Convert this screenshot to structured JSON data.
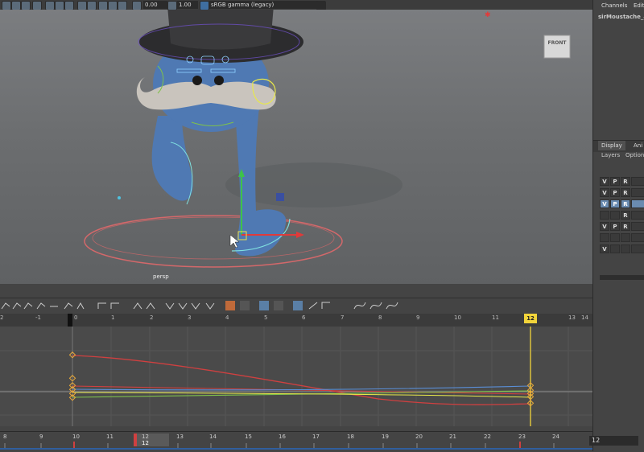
{
  "toolbar": {
    "exposure_value": "0.00",
    "gamma_value": "1.00",
    "color_space": "sRGB gamma (legacy)"
  },
  "viewport": {
    "camera_label": "persp",
    "view_cube_label": "FRONT"
  },
  "right_panel": {
    "tabs": [
      "Channels",
      "Edit"
    ],
    "object_name": "sirMoustache_ani",
    "display_tabs": [
      "Display",
      "Ani"
    ],
    "submenu": [
      "Layers",
      "Options"
    ],
    "layers": [
      {
        "flags": [
          "V",
          "P",
          "R"
        ],
        "selected": false
      },
      {
        "flags": [
          "V",
          "P",
          "R"
        ],
        "selected": false
      },
      {
        "flags": [
          "V",
          "P",
          "R"
        ],
        "selected": true
      },
      {
        "flags": [
          "",
          "",
          "R"
        ],
        "selected": false
      },
      {
        "flags": [
          "V",
          "P",
          "R"
        ],
        "selected": false
      },
      {
        "flags": [
          "",
          "",
          ""
        ],
        "selected": false
      },
      {
        "flags": [
          "V",
          "",
          ""
        ],
        "selected": false
      }
    ]
  },
  "graph_editor": {
    "ruler_labels": [
      "2",
      "-1",
      "0",
      "1",
      "2",
      "3",
      "4",
      "5",
      "6",
      "7",
      "8",
      "9",
      "10",
      "11",
      "12",
      "13",
      "14"
    ],
    "current_frame_marker": "12"
  },
  "time_slider": {
    "labels": [
      "8",
      "9",
      "10",
      "11",
      "12",
      "13",
      "14",
      "15",
      "16",
      "17",
      "18",
      "19",
      "20",
      "21",
      "22",
      "23",
      "24"
    ],
    "current_frame_label": "12",
    "current_frame_value": "12"
  },
  "colors": {
    "curve_red": "#d04040",
    "curve_green": "#7fc24a",
    "curve_blue": "#5a8fd8",
    "curve_yellow": "#e8e84a",
    "current_time": "#f2d43a",
    "character_blue": "#4f79b3",
    "moustache": "#c9c4bd"
  }
}
